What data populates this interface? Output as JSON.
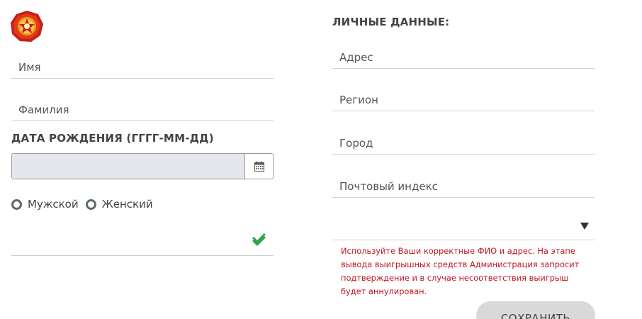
{
  "left": {
    "first_name_placeholder": "Имя",
    "last_name_placeholder": "Фамилия",
    "birth_date_label": "ДАТА РОЖДЕНИЯ (ГГГГ-ММ-ДД)",
    "birth_date_value": "",
    "gender": {
      "male_label": "Мужской",
      "female_label": "Женский"
    },
    "verified_icon": "double-check-icon"
  },
  "right": {
    "section_title": "ЛИЧНЫЕ ДАННЫЕ:",
    "address_placeholder": "Адрес",
    "region_placeholder": "Регион",
    "city_placeholder": "Город",
    "postal_code_placeholder": "Почтовый индекс",
    "country_select_value": "",
    "warning_text": "Используйте Ваши корректные ФИО и адрес. На этапе вывода выигрышных средств Администрация запросит подтверждение и в случае несоответствия выигрыш будет аннулирован.",
    "save_label": "СОХРАНИТЬ"
  },
  "colors": {
    "warning": "#c0161f",
    "check": "#2ca34a",
    "button_bg": "#d9d9d9",
    "date_input_bg": "#e4e8ec"
  }
}
